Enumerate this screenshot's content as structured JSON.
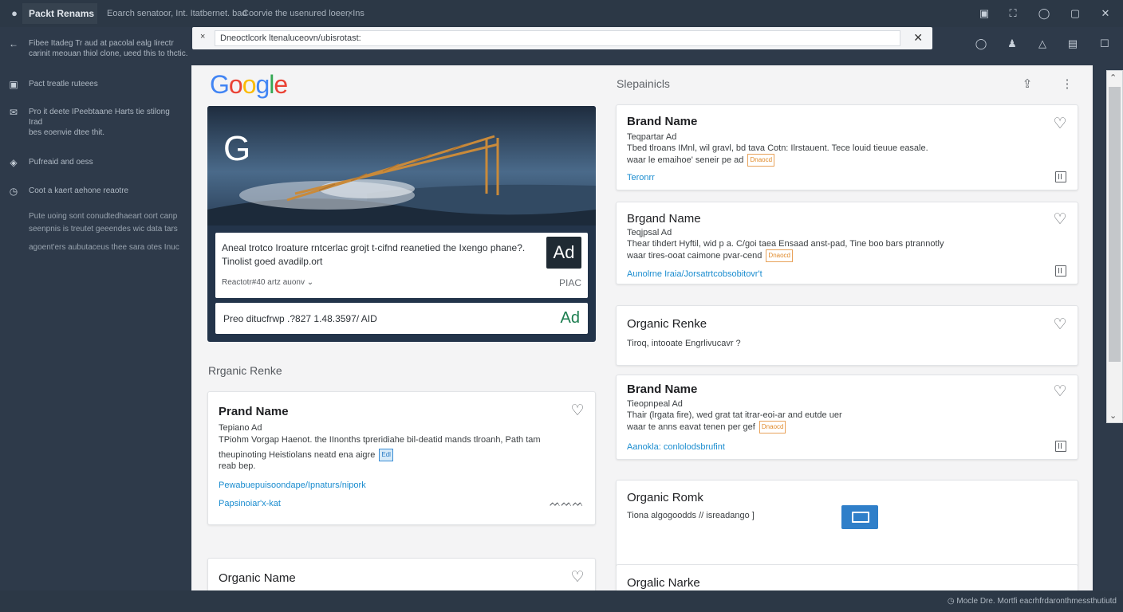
{
  "topbar": {
    "app_title": "Packt Renams",
    "text1": "Eoarch senatoor, Int. Itatbernet. bad",
    "text2": "Coorvie the usenured loeer, Ins",
    "close_glyph": "×",
    "icons": [
      "save-icon",
      "expand-icon",
      "info-icon",
      "window-icon",
      "close-icon"
    ]
  },
  "leftpanel": {
    "back_line1": "Fibee Itadeg Tr aud at pacolal ealg Iirectr",
    "back_line2": "carinit meouan thiol clone, ueed this to thctic.",
    "item1": "Pact treatle ruteees",
    "item2_line1": "Pro it deete IPeebtaane Harts tie stilong",
    "item2_line2": "Irad",
    "item2_line3": "bes eoenvie dtee thit.",
    "item3": "Pufreaid and oess",
    "item4": "Coot a kaert aehone reaotre",
    "para_line1": "Pute uoing sont conudtedhaeart oort canp",
    "para_line2": "seenpnis is treutet geeendes wic data tars",
    "para_line3": "agoent'ers aubutaceus thee sara otes Inuc"
  },
  "urlbar": {
    "url": "Dneoctlcork ltenaluceovn/ubisrotast:",
    "close_left": "×",
    "close_right": "✕"
  },
  "main": {
    "logo_letters": [
      "G",
      "o",
      "o",
      "g",
      "l",
      "e"
    ],
    "hero": {
      "g_letter": "G",
      "ad_text": "Aneal trotco Iroature rntcerlac grojt t-cifnd reanetied the Ixengo phane?. Tinolist goed avadilp.ort",
      "ad_sub": "Reactotr#40 artz auonv",
      "ad_badge": "Ad",
      "ad_code": "PIAC",
      "ad2_text": "Preo ditucfrwp .?827 1.48.3597/ AID",
      "ad2_badge": "Ad"
    },
    "organic_label": "Rrganic Renke",
    "left_card": {
      "title": "Prand Name",
      "sub": "Tepiano Ad",
      "desc1": "TPiohm Vorgap Haenot. the IInonths tpreridiahe bil-deatid mands tlroanh, Path tam",
      "desc2": "theupinoting Heistiolans neatd ena aigre",
      "desc2_tag": "Edl",
      "desc3": "reab bep.",
      "link1": "Pewabuepuisoondape/Ipnaturs/nipork",
      "link2": "Papsinoiar'x-kat",
      "squiggle": "ᨓᨓᨓ"
    },
    "left_card2": {
      "title": "Organic Name"
    },
    "right_header": "Slepainicls",
    "right_cards": [
      {
        "title": "Brand Name",
        "sub": "Teqpartar Ad",
        "desc1": "Tbed tlroans IMnl, wil gravl, bd tava Cotn: Ilrstauent. Tece louid tieuue easale.",
        "desc2": "waar le emaihoe' seneir pe ad",
        "tag": "Dnaocd",
        "link": "Teronrr"
      },
      {
        "title": "Brgand Name",
        "sub": "Teqjpsal Ad",
        "desc1": "Thear tihdert Hyftil, wid p a. C/goi taea Ensaad anst-pad, Tine boo bars ptrannotly",
        "desc2": "waar tires-ooat caimone pvar-cend",
        "tag": "Dnaocd",
        "link": "Aunolrne Iraia/Jorsatrtcobsobitovr't"
      },
      {
        "title": "Organic Renke",
        "desc1": "Tiroq, intooate Engrlivucavr ?"
      },
      {
        "title": "Brand Name",
        "sub": "Tieopnpeal Ad",
        "desc1": "Thair (lrgata fire), wed grat tat itrar-eoi-ar and eutde uer",
        "desc2": "waar te anns eavat tenen per gef",
        "tag": "Dnaocd",
        "link": "Aanokla: conlolodsbrufint"
      },
      {
        "title": "Organic Romk",
        "desc1": "Tiona algogoodds // isreadango ]"
      },
      {
        "title": "Orgalic Narke"
      }
    ]
  },
  "status": {
    "text": "Mocle Dre. Mortfi eacrhfrdaronthmessthutiutd"
  }
}
